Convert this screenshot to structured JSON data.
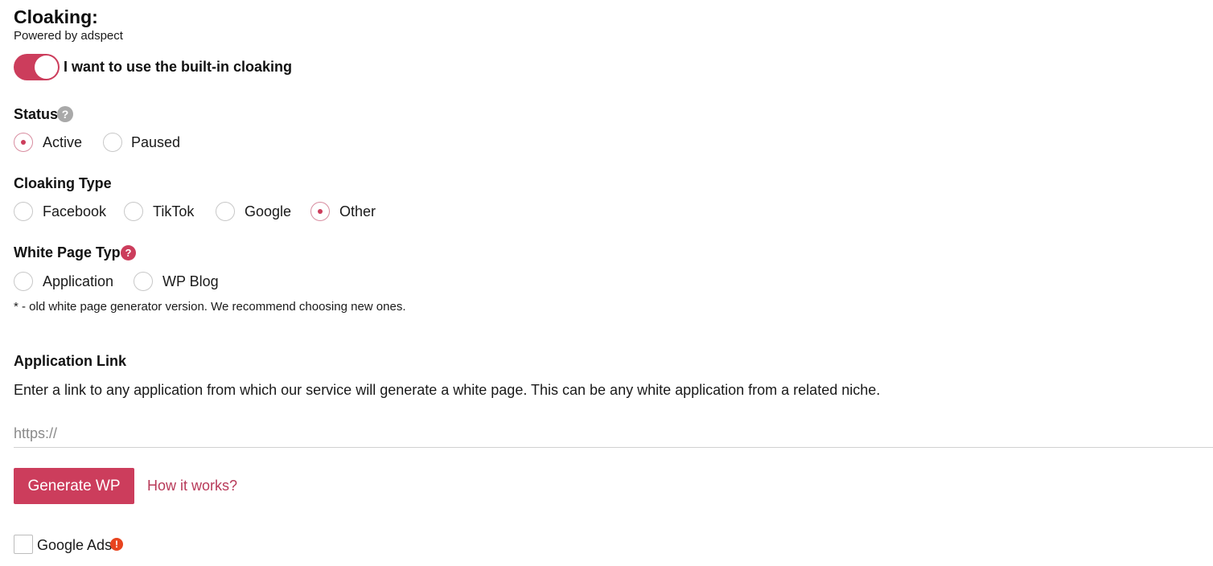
{
  "header": {
    "title": "Cloaking:",
    "subtitle": "Powered by adspect"
  },
  "toggle": {
    "label": "I want to use the built-in cloaking",
    "on": true
  },
  "status": {
    "label": "Status",
    "options": [
      "Active",
      "Paused"
    ],
    "selected": "Active"
  },
  "cloaking_type": {
    "label": "Cloaking Type",
    "options": [
      "Facebook",
      "TikTok",
      "Google",
      "Other"
    ],
    "selected": "Other"
  },
  "white_page_type": {
    "label": "White Page Type",
    "options": [
      "Application",
      "WP Blog"
    ],
    "selected": null,
    "note": "* - old white page generator version. We recommend choosing new ones."
  },
  "application_link": {
    "label": "Application Link",
    "description": "Enter a link to any application from which our service will generate a white page. This can be any white application from a related niche.",
    "placeholder": "https://",
    "value": ""
  },
  "actions": {
    "generate_label": "Generate WP",
    "how_label": "How it works?"
  },
  "google_ads": {
    "label": "Google Ads",
    "checked": false
  },
  "icons": {
    "help": "?",
    "alert": "!"
  },
  "colors": {
    "accent": "#cc3d5c",
    "help_grey": "#a9a9a9",
    "alert": "#e8441f"
  }
}
